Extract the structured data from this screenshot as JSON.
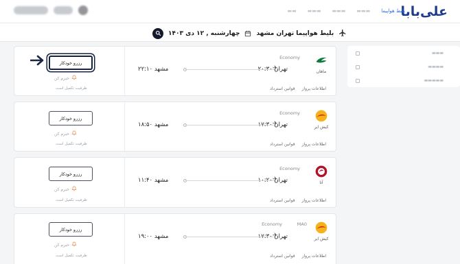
{
  "header": {
    "logo_text": "علی‌بابا",
    "nav_links": [
      "بلیط هواپیما",
      "",
      "",
      "",
      ""
    ],
    "active_index": 0
  },
  "search": {
    "title": "بلیط هواپیما تهران مشهد",
    "date": "چهارشنبه , ۱۲ دی ۱۴۰۳"
  },
  "flights": [
    {
      "airline": "ماهان",
      "cabin": "Economy",
      "aircraft": "",
      "depart_city": "تهران",
      "depart_time": "۲۰:۳۰",
      "arrive_city": "مشهد",
      "arrive_time": "۲۲:۱۰",
      "reserve_label": "رزرو خودکار",
      "notify_label": "خبرم کن",
      "capacity_label": "ظرفیت تکمیل است",
      "rules_label": "قوانین استرداد",
      "info_label": "اطلاعات پرواز",
      "logo_color": "#0f7a3e"
    },
    {
      "airline": "کیش ایر",
      "cabin": "Economy",
      "aircraft": "",
      "depart_city": "تهران",
      "depart_time": "۱۷:۳۰",
      "arrive_city": "مشهد",
      "arrive_time": "۱۸:۵۰",
      "reserve_label": "رزرو خودکار",
      "notify_label": "خبرم کن",
      "capacity_label": "ظرفیت تکمیل است",
      "rules_label": "قوانین استرداد",
      "info_label": "اطلاعات پرواز",
      "logo_color": "#f2a20f"
    },
    {
      "airline": "آتا",
      "cabin": "Economy",
      "aircraft": "",
      "depart_city": "تهران",
      "depart_time": "۱۰:۲۰",
      "arrive_city": "مشهد",
      "arrive_time": "۱۱:۴۰",
      "reserve_label": "رزرو خودکار",
      "notify_label": "خبرم کن",
      "capacity_label": "ظرفیت تکمیل است",
      "rules_label": "قوانین استرداد",
      "info_label": "اطلاعات پرواز",
      "logo_color": "#b0142a"
    },
    {
      "airline": "کیش ایر",
      "cabin": "Economy",
      "aircraft": "MA0",
      "depart_city": "تهران",
      "depart_time": "۱۷:۳۰",
      "arrive_city": "مشهد",
      "arrive_time": "۱۹:۰۰",
      "reserve_label": "رزرو خودکار",
      "notify_label": "خبرم کن",
      "capacity_label": "ظرفیت تکمیل است",
      "rules_label": "قوانین استرداد",
      "info_label": "اطلاعات پرواز",
      "logo_color": "#f2a20f"
    }
  ],
  "colors": {
    "accent": "#2f6be3",
    "brand": "#1f3b8f",
    "focus_ring": "#14223d",
    "bell": "#e8823a"
  },
  "icons": [
    "airplane-icon",
    "calendar-icon",
    "search-icon",
    "bell-icon",
    "arrow-right-icon"
  ]
}
